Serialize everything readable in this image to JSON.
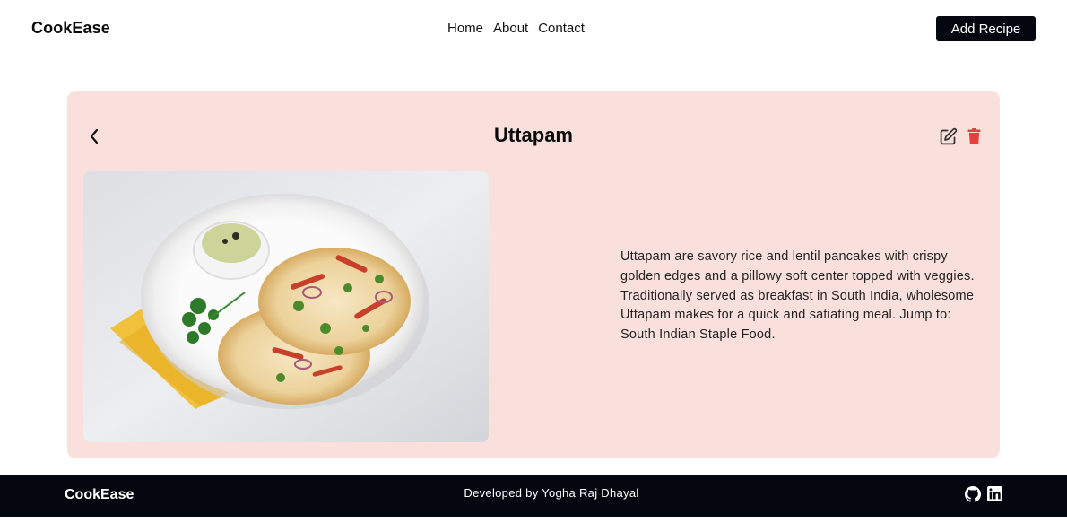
{
  "navbar": {
    "brand": "CookEase",
    "links": [
      "Home",
      "About",
      "Contact"
    ],
    "add_recipe_label": "Add Recipe"
  },
  "recipe": {
    "title": "Uttapam",
    "description": "Uttapam are savory rice and lentil pancakes with crispy golden edges and a pillowy soft center topped with veggies. Traditionally served as breakfast in South India, wholesome Uttapam makes for a quick and satiating meal. Jump to: South Indian Staple Food.",
    "icons": {
      "back": "chevron-left-icon",
      "edit": "edit-icon",
      "delete": "trash-icon"
    }
  },
  "footer": {
    "brand": "CookEase",
    "credit": "Developed by Yogha Raj Dhayal",
    "icons": [
      "github-icon",
      "linkedin-icon"
    ]
  },
  "colors": {
    "card_background": "#fae0dc",
    "dark": "#04070f",
    "delete": "#e5403d"
  }
}
